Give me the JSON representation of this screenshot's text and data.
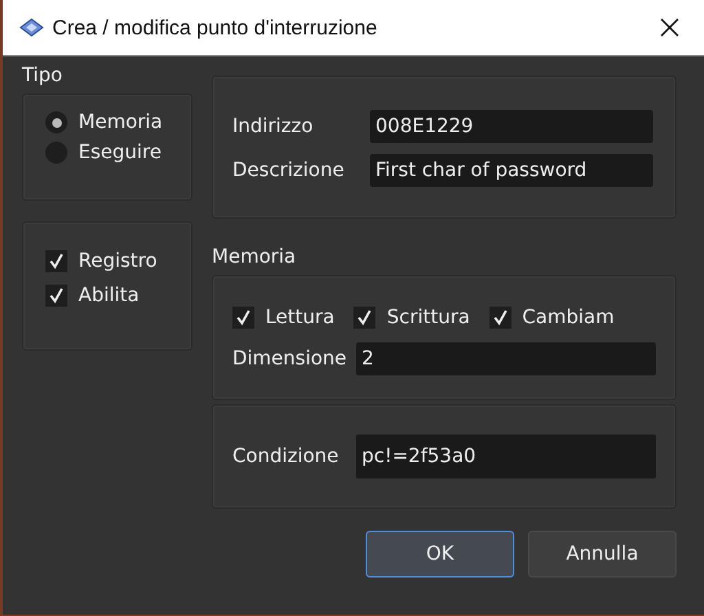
{
  "window": {
    "title": "Crea / modifica punto d'interruzione"
  },
  "tipo": {
    "label": "Tipo",
    "options": [
      {
        "label": "Memoria",
        "selected": true
      },
      {
        "label": "Eseguire",
        "selected": false
      }
    ]
  },
  "flags": [
    {
      "label": "Registro",
      "checked": true
    },
    {
      "label": "Abilita",
      "checked": true
    }
  ],
  "fields": [
    {
      "label": "Indirizzo",
      "value": "008E1229"
    },
    {
      "label": "Descrizione",
      "value": "First char of password"
    }
  ],
  "memoria": {
    "label": "Memoria",
    "access": [
      {
        "label": "Lettura",
        "checked": true
      },
      {
        "label": "Scrittura",
        "checked": true
      },
      {
        "label": "Cambiam",
        "checked": true
      }
    ],
    "size": {
      "label": "Dimensione",
      "value": "2"
    }
  },
  "condition": {
    "label": "Condizione",
    "value": "pc!=2f53a0"
  },
  "buttons": [
    {
      "label": "OK",
      "default": true
    },
    {
      "label": "Annulla",
      "default": false
    }
  ]
}
